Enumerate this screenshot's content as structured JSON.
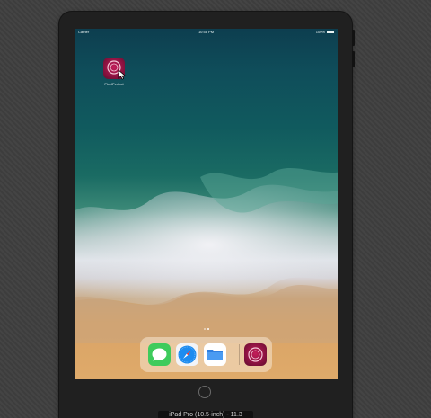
{
  "status_bar": {
    "carrier": "Carrier",
    "time": "10:58 PM",
    "battery": "100%"
  },
  "home_screen": {
    "apps": [
      {
        "label": "PixelPerfect",
        "icon": "pixelperfect-app-icon"
      }
    ],
    "page_indicator": {
      "pages": 2,
      "current": 1
    }
  },
  "dock": {
    "apps": [
      {
        "name": "Messages",
        "icon": "messages-icon",
        "color": "#34c759"
      },
      {
        "name": "Safari",
        "icon": "safari-compass-icon",
        "color": "#1d8cf0"
      },
      {
        "name": "Files",
        "icon": "files-folder-icon",
        "color": "#2f7fe0"
      }
    ],
    "recent_apps": [
      {
        "name": "PixelPerfect",
        "icon": "pixelperfect-app-icon",
        "color": "#a0164c"
      }
    ]
  },
  "device": {
    "label": "iPad Pro (10.5-inch) - 11.3"
  }
}
